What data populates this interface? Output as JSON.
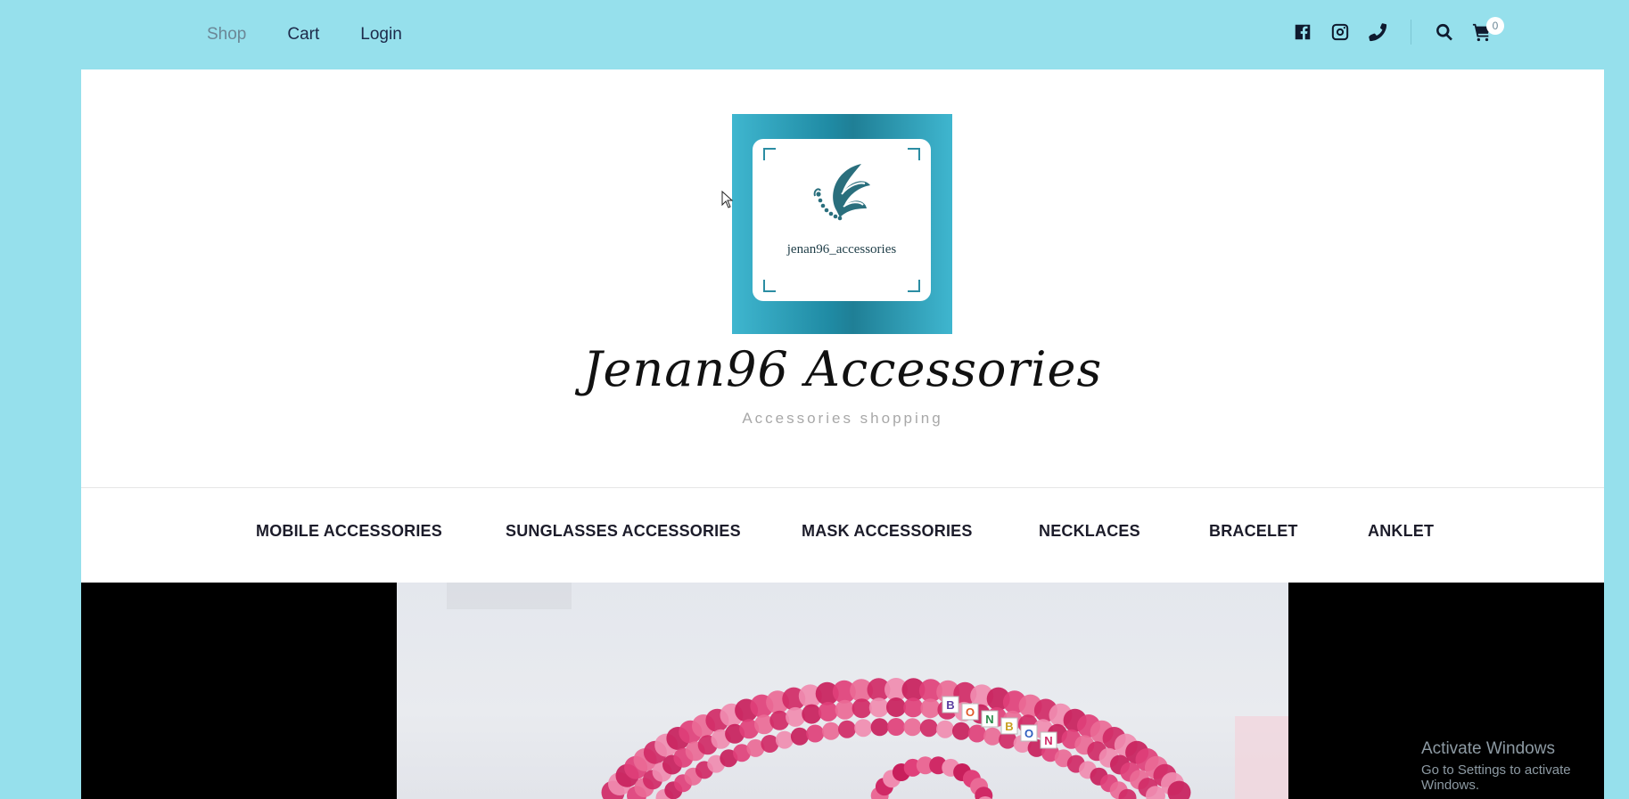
{
  "topnav": {
    "items": [
      {
        "label": "Shop"
      },
      {
        "label": "Cart"
      },
      {
        "label": "Login"
      }
    ]
  },
  "topicons": {
    "icons": [
      "facebook-icon",
      "instagram-icon",
      "phone-icon",
      "search-icon",
      "cart-icon"
    ],
    "cart_count": "0"
  },
  "header": {
    "logo_handle": "jenan96_accessories",
    "title": "Jenan96 Accessories",
    "subtitle": "Accessories shopping"
  },
  "categories": [
    {
      "label": "MOBILE ACCESSORIES"
    },
    {
      "label": "SUNGLASSES ACCESSORIES"
    },
    {
      "label": "MASK ACCESSORIES"
    },
    {
      "label": "NECKLACES"
    },
    {
      "label": "BRACELET"
    },
    {
      "label": "ANKLET"
    }
  ],
  "hero": {
    "bead_letters": [
      "B",
      "O",
      "N",
      "B",
      "O",
      "N"
    ]
  },
  "watermark": {
    "line1": "Activate Windows",
    "line2": "Go to Settings to activate Windows."
  },
  "colors": {
    "page_bg": "#96e0ec",
    "panel_bg": "#ffffff",
    "logo_teal": "#1f8aa3",
    "hero_bg": "#000000",
    "bead_pink": "#e0407a"
  }
}
